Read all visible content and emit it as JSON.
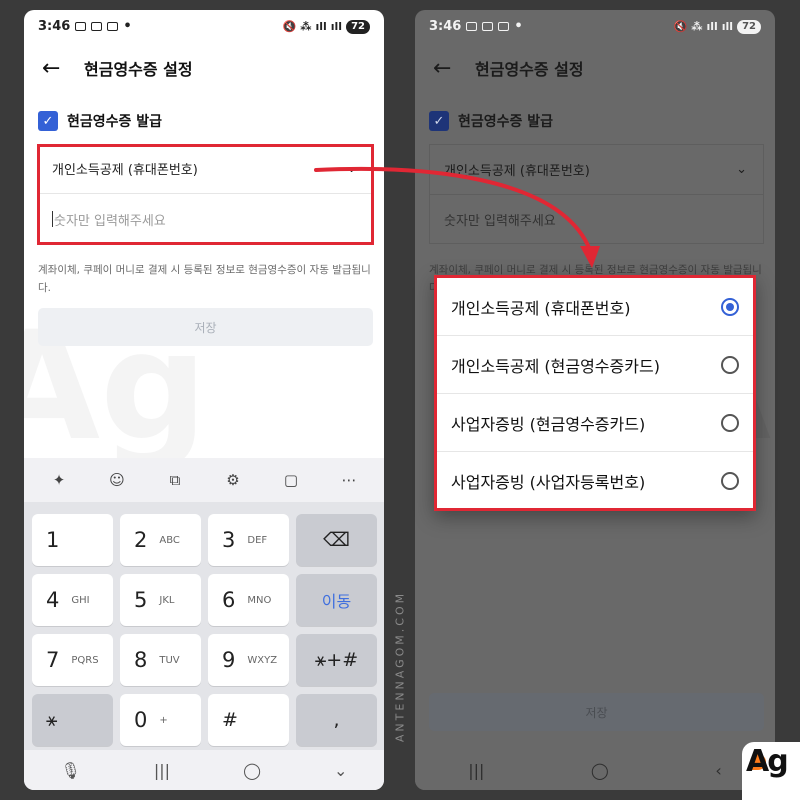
{
  "status": {
    "time": "3:46",
    "left_icons": [
      "screenshot-icon",
      "talk-icon",
      "cc-icon",
      "dot-icon"
    ],
    "battery": "72"
  },
  "app": {
    "title": "현금영수증 설정",
    "checkbox_label": "현금영수증 발급"
  },
  "form": {
    "selected_type": "개인소득공제 (휴대폰번호)",
    "input_placeholder": "숫자만 입력해주세요",
    "info": "계좌이체, 쿠페이 머니로 결제 시 등록된 정보로 현금영수증이 자동 발급됩니다.",
    "save_label": "저장"
  },
  "keyboard": {
    "toolbar_icons": [
      "sparkle-icon",
      "emoji-icon",
      "translate-icon",
      "settings-icon",
      "clipboard-icon",
      "more-icon"
    ],
    "keys": [
      {
        "num": "1",
        "sub": ""
      },
      {
        "num": "2",
        "sub": "ABC"
      },
      {
        "num": "3",
        "sub": "DEF"
      },
      {
        "num": "4",
        "sub": "GHI"
      },
      {
        "num": "5",
        "sub": "JKL"
      },
      {
        "num": "6",
        "sub": "MNO"
      },
      {
        "num": "7",
        "sub": "PQRS"
      },
      {
        "num": "8",
        "sub": "TUV"
      },
      {
        "num": "9",
        "sub": "WXYZ"
      },
      {
        "num": "0",
        "sub": "+"
      }
    ],
    "backspace": "⌫",
    "move": "이동",
    "symbols": "⚹+#",
    "star": "⚹",
    "hash": "#",
    "comma": ","
  },
  "dropdown_options": [
    {
      "label": "개인소득공제 (휴대폰번호)",
      "selected": true
    },
    {
      "label": "개인소득공제 (현금영수증카드)",
      "selected": false
    },
    {
      "label": "사업자증빙 (현금영수증카드)",
      "selected": false
    },
    {
      "label": "사업자증빙 (사업자등록번호)",
      "selected": false
    }
  ],
  "watermark": "ANTENNAGOM.COM",
  "logo": "Ag",
  "colors": {
    "accent": "#3461d6",
    "highlight": "#e02734"
  }
}
